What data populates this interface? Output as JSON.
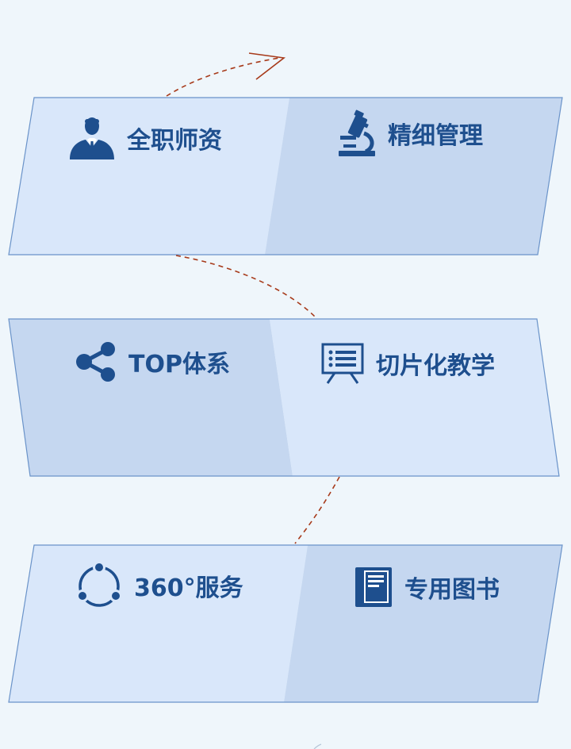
{
  "colors": {
    "background": "#eff6fb",
    "card_light": "#d9e7fa",
    "card_dark": "#c5d7f0",
    "card_border": "#6a93c9",
    "text_primary": "#1e4f8e",
    "icon": "#1e4f8e",
    "connector": "#a73a1a"
  },
  "rows": [
    {
      "left": {
        "label": "全职师资",
        "icon": "businessman-icon"
      },
      "right": {
        "label": "精细管理",
        "icon": "microscope-icon"
      }
    },
    {
      "left": {
        "label": "TOP体系",
        "icon": "share-icon"
      },
      "right": {
        "label": "切片化教学",
        "icon": "presentation-board-icon"
      }
    },
    {
      "left": {
        "label": "360°服务",
        "icon": "cycle-icon"
      },
      "right": {
        "label": "专用图书",
        "icon": "book-icon"
      }
    }
  ]
}
